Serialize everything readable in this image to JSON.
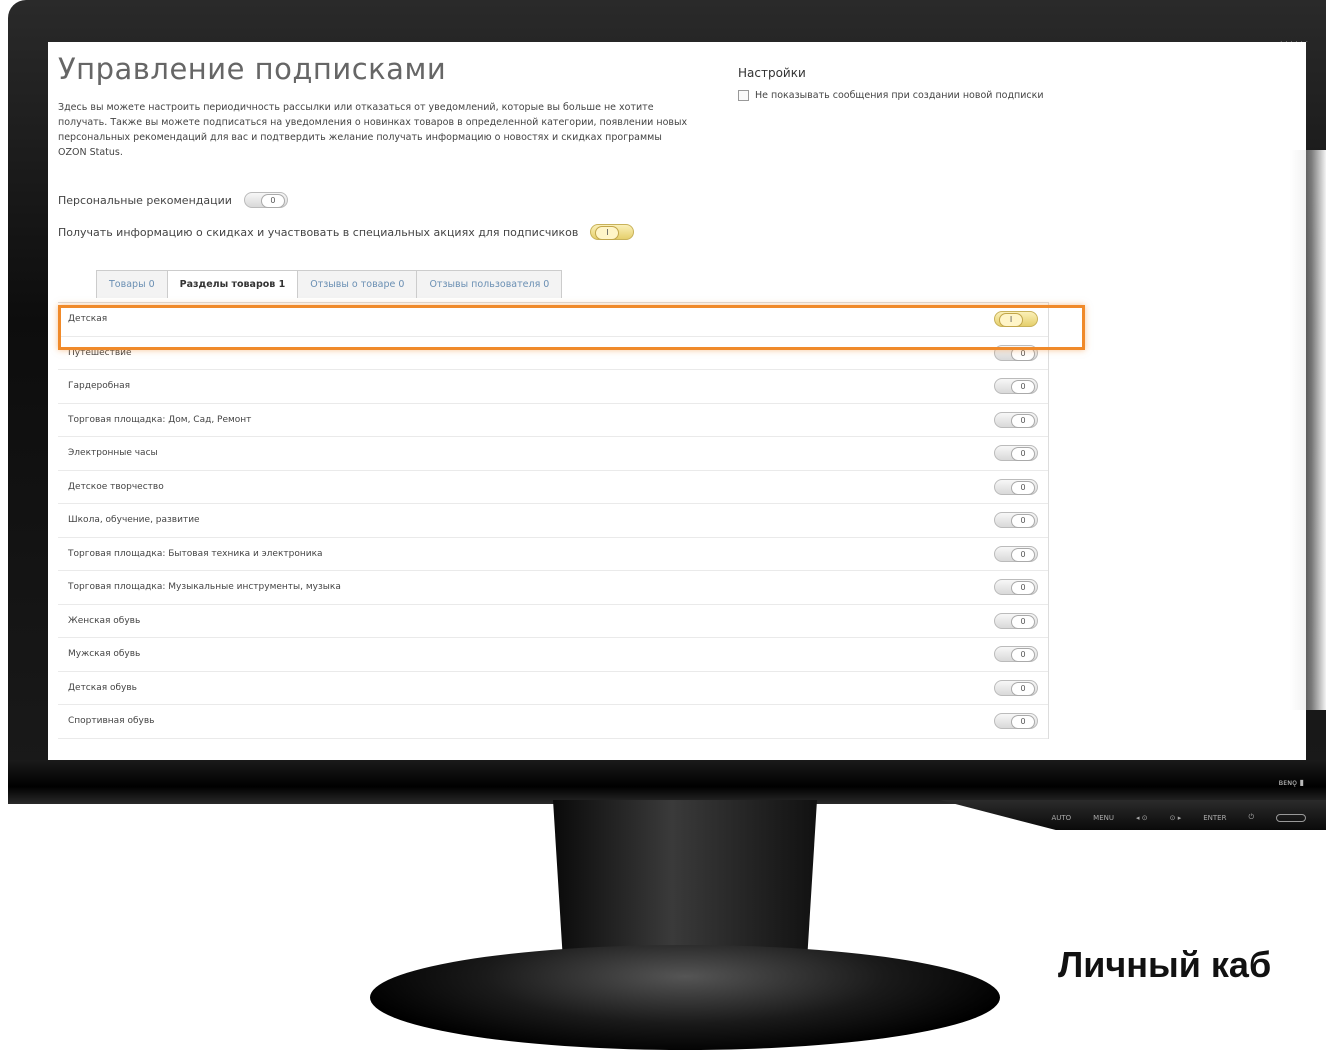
{
  "page": {
    "title": "Управление подписками",
    "description": "Здесь вы можете настроить периодичность рассылки или отказаться от уведомлений, которые вы больше не хотите получать. Также вы можете подписаться на уведомления о новинках товаров в определенной категории, появлении новых персональных рекомендаций для вас и подтвердить желание получать информацию о новостях и скидках программы OZON Status."
  },
  "settings": {
    "title": "Настройки",
    "option_label": "Не показывать сообщения при создании новой подписки",
    "option_checked": false
  },
  "preferences": [
    {
      "label": "Персональные рекомендации",
      "state": "off"
    },
    {
      "label": "Получать информацию о скидках и участвовать в специальных акциях для подписчиков",
      "state": "on"
    }
  ],
  "tabs": [
    {
      "label": "Товары 0",
      "active": false
    },
    {
      "label": "Разделы товаров 1",
      "active": true
    },
    {
      "label": "Отзывы о товаре 0",
      "active": false
    },
    {
      "label": "Отзывы пользователя 0",
      "active": false
    }
  ],
  "categories": [
    {
      "label": "Детская",
      "state": "on"
    },
    {
      "label": "Путешествие",
      "state": "off"
    },
    {
      "label": "Гардеробная",
      "state": "off"
    },
    {
      "label": "Торговая площадка: Дом, Сад, Ремонт",
      "state": "off"
    },
    {
      "label": "Электронные часы",
      "state": "off"
    },
    {
      "label": "Детское творчество",
      "state": "off"
    },
    {
      "label": "Школа, обучение, развитие",
      "state": "off"
    },
    {
      "label": "Торговая площадка: Бытовая техника и электроника",
      "state": "off"
    },
    {
      "label": "Торговая площадка: Музыкальные инструменты, музыка",
      "state": "off"
    },
    {
      "label": "Женская обувь",
      "state": "off"
    },
    {
      "label": "Мужская обувь",
      "state": "off"
    },
    {
      "label": "Детская обувь",
      "state": "off"
    },
    {
      "label": "Спортивная обувь",
      "state": "off"
    }
  ],
  "highlight_color": "#f08a2a",
  "monitor": {
    "buttons": [
      "AUTO",
      "MENU",
      "◂ ⊙",
      "⊙ ▸",
      "ENTER",
      "⏻"
    ]
  },
  "caption": "Личный каб"
}
